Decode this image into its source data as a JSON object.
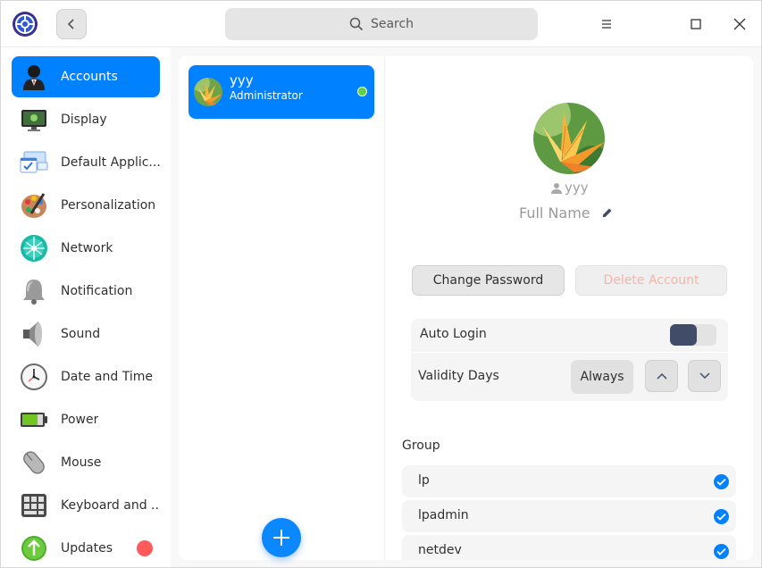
{
  "titlebar": {
    "search_placeholder": "Search",
    "icons": [
      "app-logo-icon",
      "back-icon",
      "search-icon",
      "menu-icon",
      "maximize-icon",
      "close-icon"
    ]
  },
  "sidebar": {
    "items": [
      {
        "label": "Accounts",
        "icon": "accounts-icon",
        "active": true
      },
      {
        "label": "Display",
        "icon": "display-icon"
      },
      {
        "label": "Default Applic...",
        "icon": "default-apps-icon"
      },
      {
        "label": "Personalization",
        "icon": "personalization-icon"
      },
      {
        "label": "Network",
        "icon": "network-icon"
      },
      {
        "label": "Notification",
        "icon": "notification-icon"
      },
      {
        "label": "Sound",
        "icon": "sound-icon"
      },
      {
        "label": "Date and Time",
        "icon": "clock-icon"
      },
      {
        "label": "Power",
        "icon": "battery-icon"
      },
      {
        "label": "Mouse",
        "icon": "mouse-icon"
      },
      {
        "label": "Keyboard and ...",
        "icon": "keyboard-icon"
      },
      {
        "label": "Updates",
        "icon": "updates-icon",
        "badge": true
      }
    ]
  },
  "userlist": {
    "users": [
      {
        "name": "yyy",
        "role": "Administrator",
        "online": true
      }
    ]
  },
  "detail": {
    "account_name": "yyy",
    "full_name": "Full Name",
    "change_password": "Change Password",
    "delete_account": "Delete Account",
    "auto_login_label": "Auto Login",
    "auto_login_on": false,
    "validity_label": "Validity Days",
    "validity_value": "Always",
    "group_title": "Group",
    "groups": [
      {
        "name": "lp",
        "checked": true
      },
      {
        "name": "lpadmin",
        "checked": true
      },
      {
        "name": "netdev",
        "checked": true
      }
    ]
  },
  "colors": {
    "accent": "#0081ff",
    "badge": "#ff5a5a",
    "online": "#5ed146",
    "toggle_knob": "#414d68",
    "delete_text": "#f3b5ab"
  }
}
